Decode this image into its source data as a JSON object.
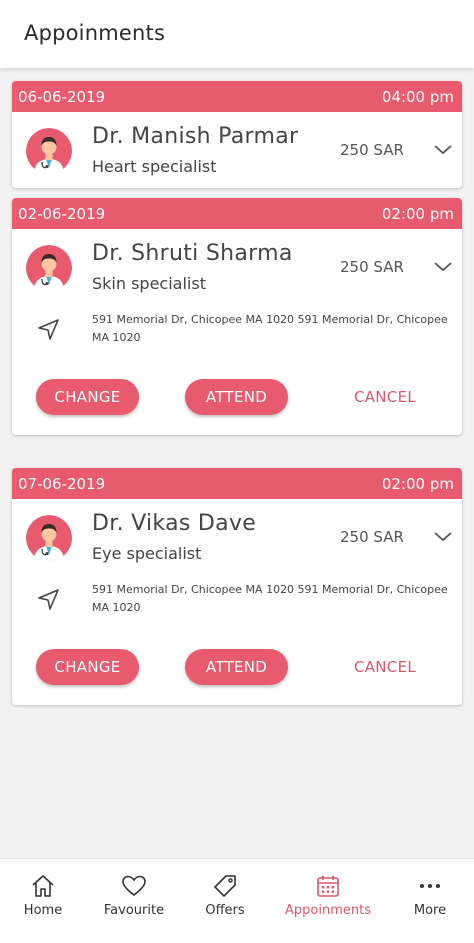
{
  "header": {
    "title": "Appoinments"
  },
  "colors": {
    "accent": "#e85a6e",
    "text": "#444444",
    "active_nav": "#d8586a"
  },
  "appointments": [
    {
      "date": "06-06-2019",
      "time": "04:00 pm",
      "doctor": "Dr. Manish Parmar",
      "specialty": "Heart specialist",
      "fee": "250 SAR",
      "expanded": false
    },
    {
      "date": "02-06-2019",
      "time": "02:00 pm",
      "doctor": "Dr. Shruti Sharma",
      "specialty": "Skin specialist",
      "fee": "250 SAR",
      "expanded": true,
      "address": "591 Memorial Dr, Chicopee MA 1020 591 Memorial Dr, Chicopee MA 1020",
      "change_label": "CHANGE",
      "attend_label": "ATTEND",
      "cancel_label": "CANCEL"
    },
    {
      "date": "07-06-2019",
      "time": "02:00 pm",
      "doctor": "Dr. Vikas Dave",
      "specialty": "Eye specialist",
      "fee": "250 SAR",
      "expanded": true,
      "address": "591 Memorial Dr, Chicopee MA 1020 591 Memorial Dr, Chicopee MA 1020",
      "change_label": "CHANGE",
      "attend_label": "ATTEND",
      "cancel_label": "CANCEL"
    }
  ],
  "bottom_nav": [
    {
      "label": "Home",
      "icon": "home-icon",
      "active": false
    },
    {
      "label": "Favourite",
      "icon": "heart-icon",
      "active": false
    },
    {
      "label": "Offers",
      "icon": "tag-icon",
      "active": false
    },
    {
      "label": "Appoinments",
      "icon": "calendar-icon",
      "active": true
    },
    {
      "label": "More",
      "icon": "more-icon",
      "active": false
    }
  ]
}
